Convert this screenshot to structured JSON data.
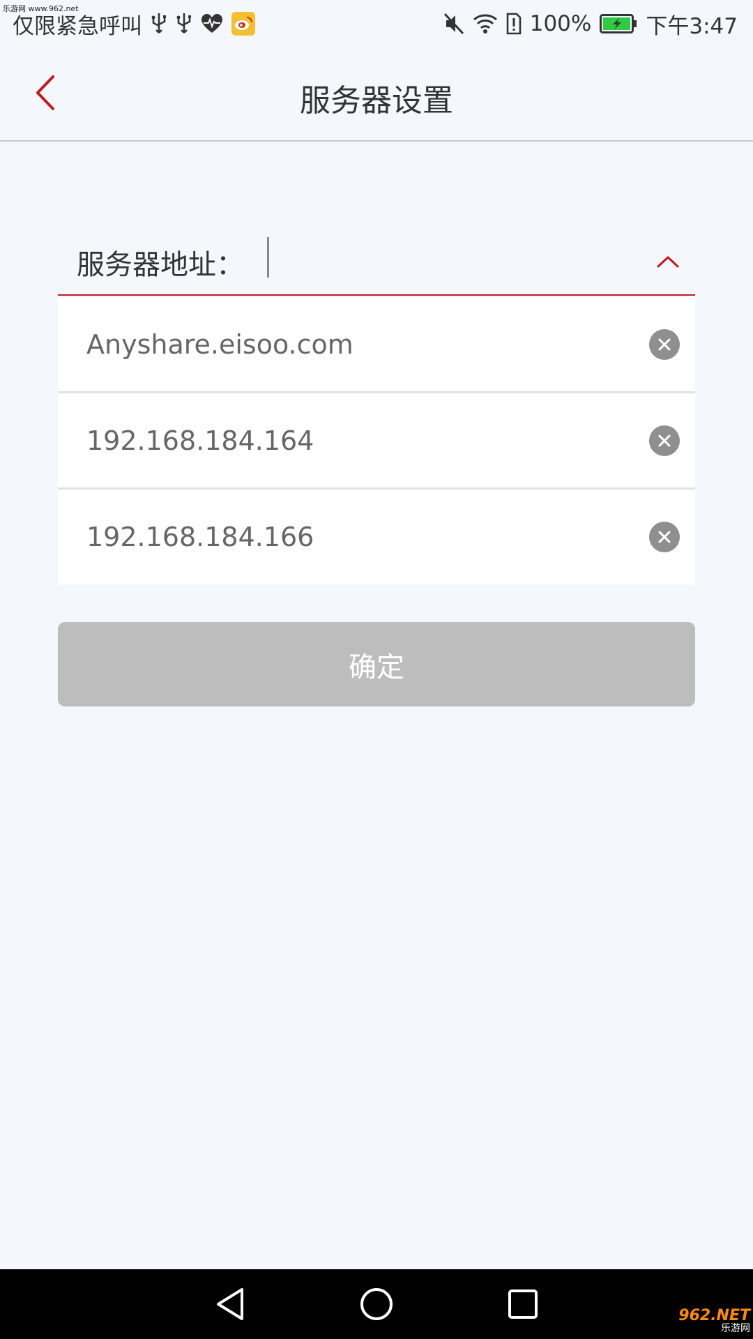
{
  "watermark": {
    "top_text": "乐游网 www.962.net",
    "bottom_big": "962.NET",
    "bottom_small": "乐游网"
  },
  "statusbar": {
    "left_text": "仅限紧急呼叫",
    "battery": "100%",
    "time": "下午3:47"
  },
  "header": {
    "title": "服务器设置"
  },
  "server": {
    "label": "服务器地址：",
    "input_value": ""
  },
  "servers": [
    {
      "address": "Anyshare.eisoo.com"
    },
    {
      "address": "192.168.184.164"
    },
    {
      "address": "192.168.184.166"
    }
  ],
  "actions": {
    "confirm_label": "确定"
  },
  "colors": {
    "accent": "#c8161d",
    "button_disabled": "#bdbdbd",
    "background": "#f4f8fd"
  }
}
